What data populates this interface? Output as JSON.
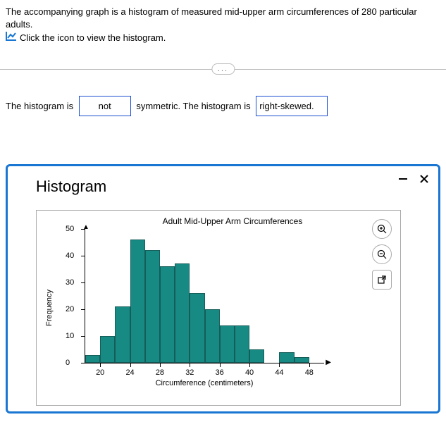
{
  "intro": {
    "line1": "The accompanying graph is a histogram of measured mid-upper arm circumferences of 280 particular adults.",
    "line2": "Click the icon to view the histogram."
  },
  "divider": {
    "label": "..."
  },
  "answer": {
    "t1": "The histogram is",
    "blank1": "not",
    "t2": "symmetric. The histogram is",
    "blank2": "right-skewed.",
    "t3": ""
  },
  "modal": {
    "title": "Histogram",
    "minimize": "minimize",
    "close": "close"
  },
  "tools": {
    "zoom_in": "zoom-in",
    "zoom_out": "zoom-out",
    "popout": "popout"
  },
  "chart_data": {
    "type": "bar",
    "title": "Adult Mid-Upper Arm Circumferences",
    "xlabel": "Circumference (centimeters)",
    "ylabel": "Frequency",
    "ylim": [
      0,
      50
    ],
    "xlim": [
      18,
      50
    ],
    "yticks": [
      0,
      10,
      20,
      30,
      40,
      50
    ],
    "xticks": [
      20,
      24,
      28,
      32,
      36,
      40,
      44,
      48
    ],
    "bin_edges": [
      18,
      20,
      22,
      24,
      26,
      28,
      30,
      32,
      34,
      36,
      38,
      40,
      42,
      44,
      46,
      48
    ],
    "values": [
      3,
      10,
      21,
      46,
      42,
      36,
      37,
      26,
      20,
      14,
      14,
      5,
      0,
      4,
      2
    ]
  }
}
